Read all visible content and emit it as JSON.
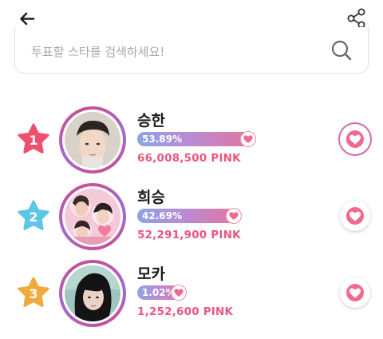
{
  "search": {
    "placeholder": "투표할 스타를 검색하세요!"
  },
  "ranking": [
    {
      "rank": "1",
      "name": "승한",
      "percent_label": "53.89%",
      "percent": 53.89,
      "pink": "66,008,500 PINK",
      "star_color": "#f0506e"
    },
    {
      "rank": "2",
      "name": "희승",
      "percent_label": "42.69%",
      "percent": 42.69,
      "pink": "52,291,900 PINK",
      "star_color": "#5cc6e6"
    },
    {
      "rank": "3",
      "name": "모카",
      "percent_label": "1.02%",
      "percent": 1.02,
      "pink": "1,252,600 PINK",
      "star_color": "#f2a93b"
    }
  ],
  "colors": {
    "pink": "#e8577f",
    "bar_start": "#8fa3e6",
    "bar_end": "#e8739e"
  },
  "icons": [
    "back-arrow-icon",
    "share-icon",
    "search-icon",
    "star-badge-icon",
    "heart-icon"
  ]
}
